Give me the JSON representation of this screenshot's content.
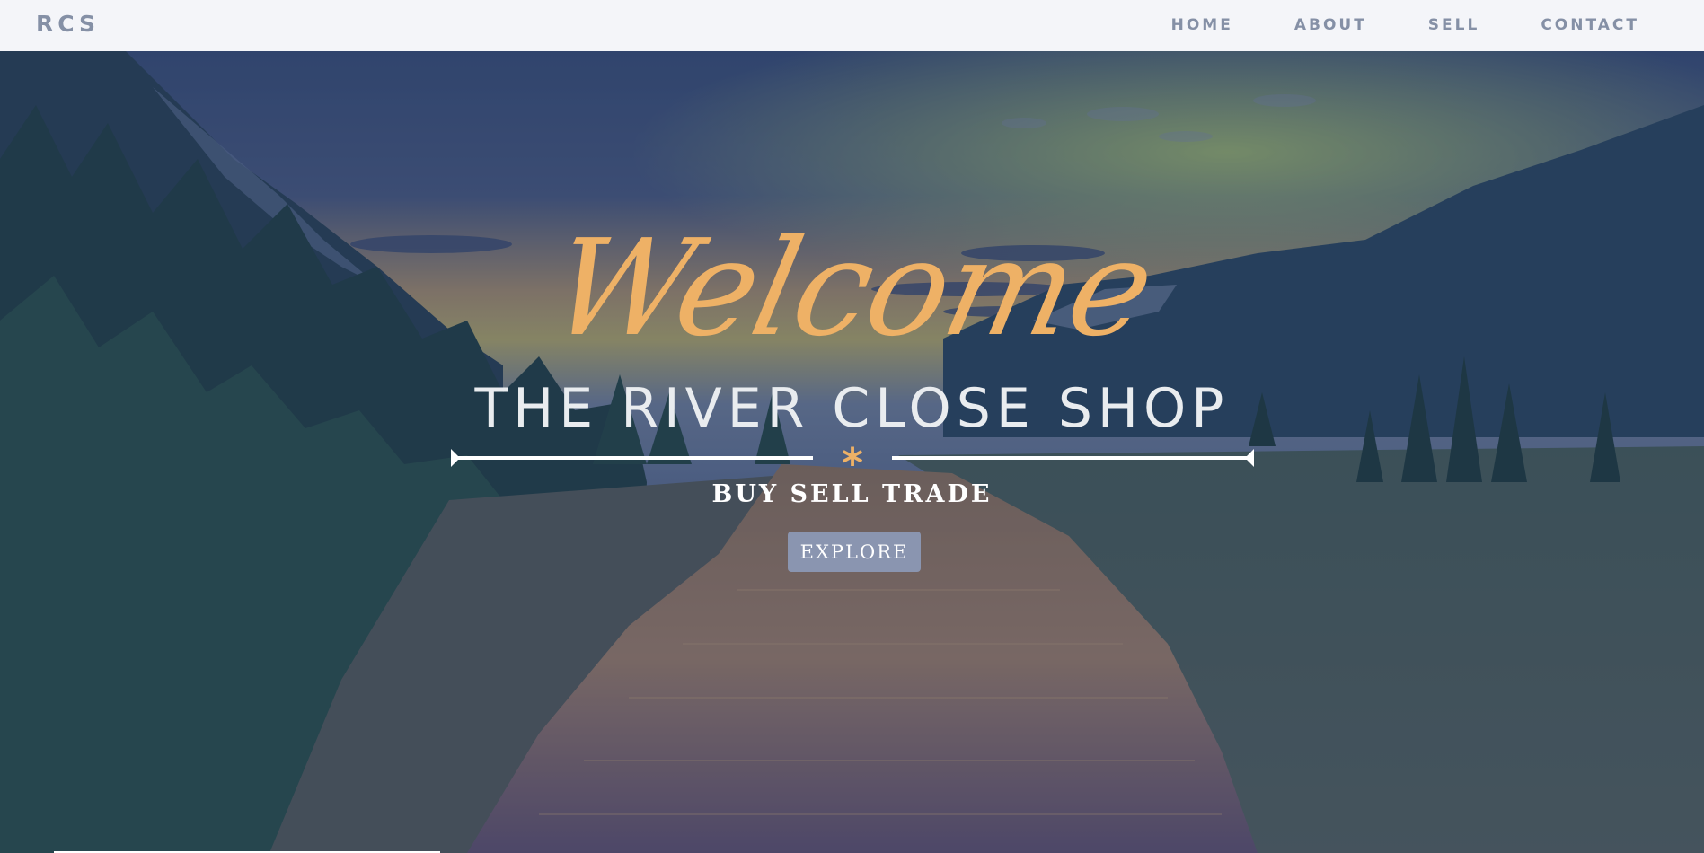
{
  "navbar": {
    "brand": "RCS",
    "links": [
      {
        "label": "HOME"
      },
      {
        "label": "ABOUT"
      },
      {
        "label": "SELL"
      },
      {
        "label": "CONTACT"
      }
    ]
  },
  "hero": {
    "welcome": "Welcome",
    "title": "THE RIVER CLOSE SHOP",
    "divider_glyph": "*",
    "tagline": "BUY SELL TRADE",
    "cta_label": "EXPLORE"
  },
  "colors": {
    "nav_bg": "#f4f5f9",
    "nav_text": "#8590a6",
    "accent_gold": "#eeb166",
    "button_bg": "#8a95b0",
    "title_text": "#e9ecef"
  }
}
